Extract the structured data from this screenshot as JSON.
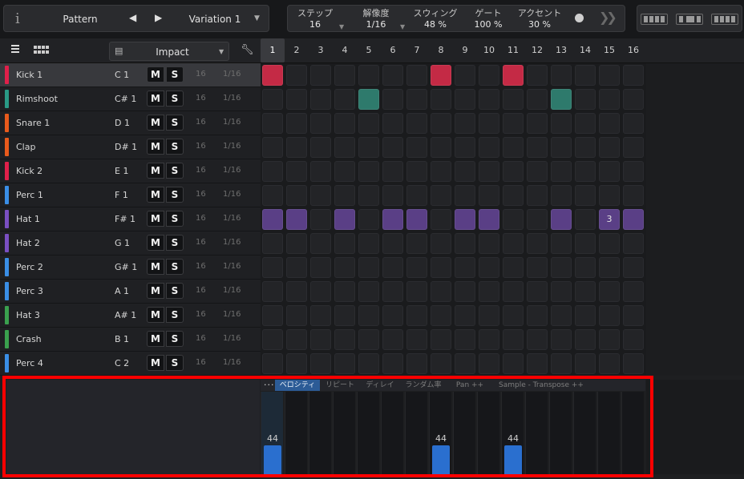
{
  "toolbar": {
    "info_icon": "info-icon",
    "pattern_label": "Pattern",
    "prev_icon": "triangle-left",
    "next_icon": "triangle-right",
    "variation_label": "Variation 1",
    "params": [
      {
        "name": "ステップ",
        "value": "16",
        "has_dropdown": true
      },
      {
        "name": "解像度",
        "value": "1/16",
        "has_dropdown": true
      },
      {
        "name": "スウィング",
        "value": "48 %",
        "has_dropdown": false
      },
      {
        "name": "ゲート",
        "value": "100 %",
        "has_dropdown": false
      },
      {
        "name": "アクセント",
        "value": "30 %",
        "has_dropdown": false
      }
    ]
  },
  "header": {
    "kit_name": "Impact",
    "steps": [
      "1",
      "2",
      "3",
      "4",
      "5",
      "6",
      "7",
      "8",
      "9",
      "10",
      "11",
      "12",
      "13",
      "14",
      "15",
      "16"
    ],
    "current_step": 1
  },
  "colors": {
    "red": "#c42a45",
    "teal": "#2e7a6c",
    "purple": "#5a3f86",
    "orange": "#e05a22",
    "blue": "#3a8ee6",
    "green": "#3aa04e",
    "velocity": "#2a6fcf",
    "highlight": "#ff0000"
  },
  "tracks": [
    {
      "name": "Kick 1",
      "note": "C 1",
      "mute": "M",
      "solo": "S",
      "steps": "16",
      "res": "1/16",
      "color": "#e0204a",
      "selected": true,
      "pattern": [
        1,
        8,
        11
      ],
      "cell_color": "#c42a45"
    },
    {
      "name": "Rimshoot",
      "note": "C# 1",
      "mute": "M",
      "solo": "S",
      "steps": "16",
      "res": "1/16",
      "color": "#2a9a86",
      "selected": false,
      "pattern": [
        5,
        13
      ],
      "cell_color": "#2e7a6c"
    },
    {
      "name": "Snare 1",
      "note": "D 1",
      "mute": "M",
      "solo": "S",
      "steps": "16",
      "res": "1/16",
      "color": "#e85a1c",
      "selected": false,
      "pattern": [],
      "cell_color": "#c45a2a"
    },
    {
      "name": "Clap",
      "note": "D# 1",
      "mute": "M",
      "solo": "S",
      "steps": "16",
      "res": "1/16",
      "color": "#e85a1c",
      "selected": false,
      "pattern": [],
      "cell_color": "#c45a2a"
    },
    {
      "name": "Kick 2",
      "note": "E 1",
      "mute": "M",
      "solo": "S",
      "steps": "16",
      "res": "1/16",
      "color": "#e0204a",
      "selected": false,
      "pattern": [],
      "cell_color": "#c42a45"
    },
    {
      "name": "Perc 1",
      "note": "F 1",
      "mute": "M",
      "solo": "S",
      "steps": "16",
      "res": "1/16",
      "color": "#3a8ee6",
      "selected": false,
      "pattern": [],
      "cell_color": "#2a6fcf"
    },
    {
      "name": "Hat 1",
      "note": "F# 1",
      "mute": "M",
      "solo": "S",
      "steps": "16",
      "res": "1/16",
      "color": "#7a4fc2",
      "selected": false,
      "pattern": [
        1,
        2,
        4,
        6,
        7,
        9,
        10,
        13,
        15,
        16
      ],
      "cell_color": "#5a3f86",
      "cell_labels": {
        "15": "3"
      }
    },
    {
      "name": "Hat 2",
      "note": "G 1",
      "mute": "M",
      "solo": "S",
      "steps": "16",
      "res": "1/16",
      "color": "#7a4fc2",
      "selected": false,
      "pattern": [],
      "cell_color": "#5a3f86"
    },
    {
      "name": "Perc 2",
      "note": "G# 1",
      "mute": "M",
      "solo": "S",
      "steps": "16",
      "res": "1/16",
      "color": "#3a8ee6",
      "selected": false,
      "pattern": [],
      "cell_color": "#2a6fcf"
    },
    {
      "name": "Perc 3",
      "note": "A 1",
      "mute": "M",
      "solo": "S",
      "steps": "16",
      "res": "1/16",
      "color": "#3a8ee6",
      "selected": false,
      "pattern": [],
      "cell_color": "#2a6fcf"
    },
    {
      "name": "Hat 3",
      "note": "A# 1",
      "mute": "M",
      "solo": "S",
      "steps": "16",
      "res": "1/16",
      "color": "#3aa04e",
      "selected": false,
      "pattern": [],
      "cell_color": "#3a8a4e"
    },
    {
      "name": "Crash",
      "note": "B 1",
      "mute": "M",
      "solo": "S",
      "steps": "16",
      "res": "1/16",
      "color": "#3aa04e",
      "selected": false,
      "pattern": [],
      "cell_color": "#3a8a4e"
    },
    {
      "name": "Perc 4",
      "note": "C 2",
      "mute": "M",
      "solo": "S",
      "steps": "16",
      "res": "1/16",
      "color": "#3a8ee6",
      "selected": false,
      "pattern": [],
      "cell_color": "#2a6fcf"
    }
  ],
  "editor": {
    "more_label": "...",
    "tabs": [
      "ベロシティ",
      "リピート",
      "ディレイ",
      "ランダム率",
      "Pan ++",
      "Sample - Transpose ++"
    ],
    "active_tab": 0,
    "velocity_max": 127,
    "velocities": [
      {
        "step": 1,
        "value": 44
      },
      {
        "step": 8,
        "value": 44
      },
      {
        "step": 11,
        "value": 44
      }
    ]
  }
}
